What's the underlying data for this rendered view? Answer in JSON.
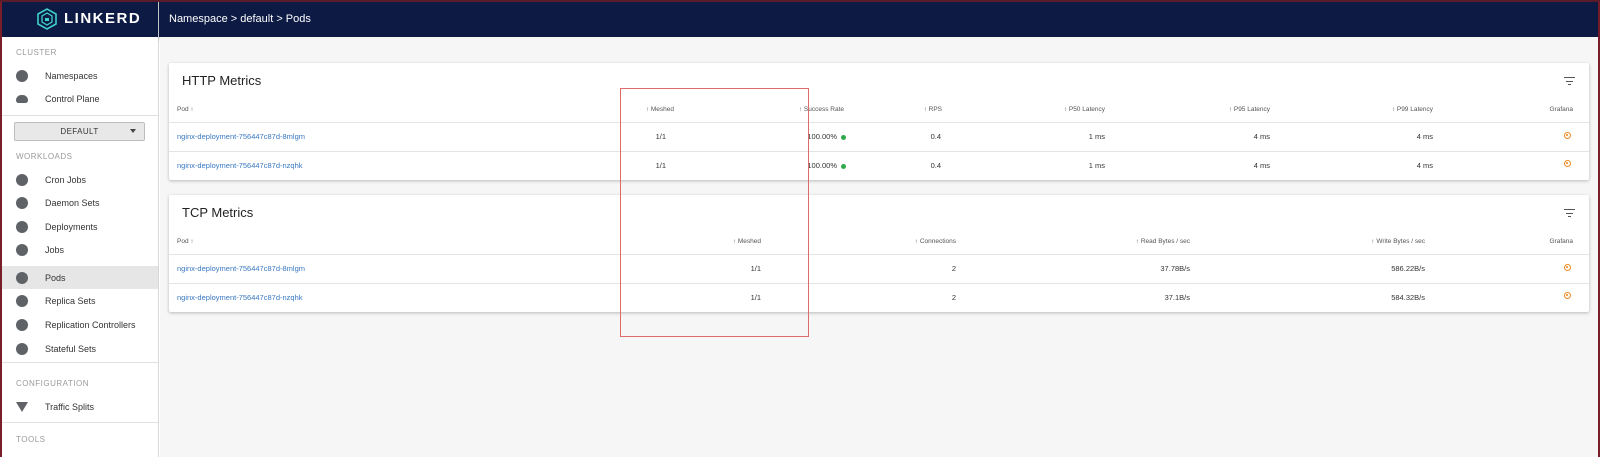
{
  "brand": {
    "logo_text": "LINKERD"
  },
  "breadcrumb": {
    "text": "Namespace > default > Pods"
  },
  "sidebar": {
    "cluster_label": "CLUSTER",
    "cluster_items": [
      {
        "label": "Namespaces",
        "icon": "namespaces-icon"
      },
      {
        "label": "Control Plane",
        "icon": "cloud-icon"
      }
    ],
    "namespace_select": "DEFAULT",
    "workloads_label": "WORKLOADS",
    "workload_items": [
      {
        "label": "Cron Jobs"
      },
      {
        "label": "Daemon Sets"
      },
      {
        "label": "Deployments"
      },
      {
        "label": "Jobs"
      },
      {
        "label": "Pods"
      },
      {
        "label": "Replica Sets"
      },
      {
        "label": "Replication Controllers"
      },
      {
        "label": "Stateful Sets"
      }
    ],
    "configuration_label": "CONFIGURATION",
    "configuration_items": [
      {
        "label": "Traffic Splits"
      }
    ],
    "tools_label": "TOOLS"
  },
  "http": {
    "title": "HTTP Metrics",
    "headers": {
      "pod": "Pod ↑",
      "meshed": "↑ Meshed",
      "success": "↑ Success Rate",
      "rps": "↑ RPS",
      "p50": "↑ P50 Latency",
      "p95": "↑ P95 Latency",
      "p99": "↑ P99 Latency",
      "grafana": "Grafana"
    },
    "rows": [
      {
        "pod": "nginx-deployment-756447c87d-8mlgm",
        "meshed": "1/1",
        "success": "100.00%",
        "rps": "0.4",
        "p50": "1 ms",
        "p95": "4 ms",
        "p99": "4 ms"
      },
      {
        "pod": "nginx-deployment-756447c87d-nzqhk",
        "meshed": "1/1",
        "success": "100.00%",
        "rps": "0.4",
        "p50": "1 ms",
        "p95": "4 ms",
        "p99": "4 ms"
      }
    ]
  },
  "tcp": {
    "title": "TCP Metrics",
    "headers": {
      "pod": "Pod ↑",
      "meshed": "↑ Meshed",
      "connections": "↑ Connections",
      "read": "↑ Read Bytes / sec",
      "write": "↑ Write Bytes / sec",
      "grafana": "Grafana"
    },
    "rows": [
      {
        "pod": "nginx-deployment-756447c87d-8mlgm",
        "meshed": "1/1",
        "connections": "2",
        "read": "37.78B/s",
        "write": "586.22B/s"
      },
      {
        "pod": "nginx-deployment-756447c87d-nzqhk",
        "meshed": "1/1",
        "connections": "2",
        "read": "37.1B/s",
        "write": "584.32B/s"
      }
    ]
  },
  "colors": {
    "header_bg": "#0c1a44",
    "link": "#3a78c2",
    "status_ok": "#2eaa4a",
    "grafana": "#f08a24",
    "highlight_box": "#e06a6a"
  }
}
